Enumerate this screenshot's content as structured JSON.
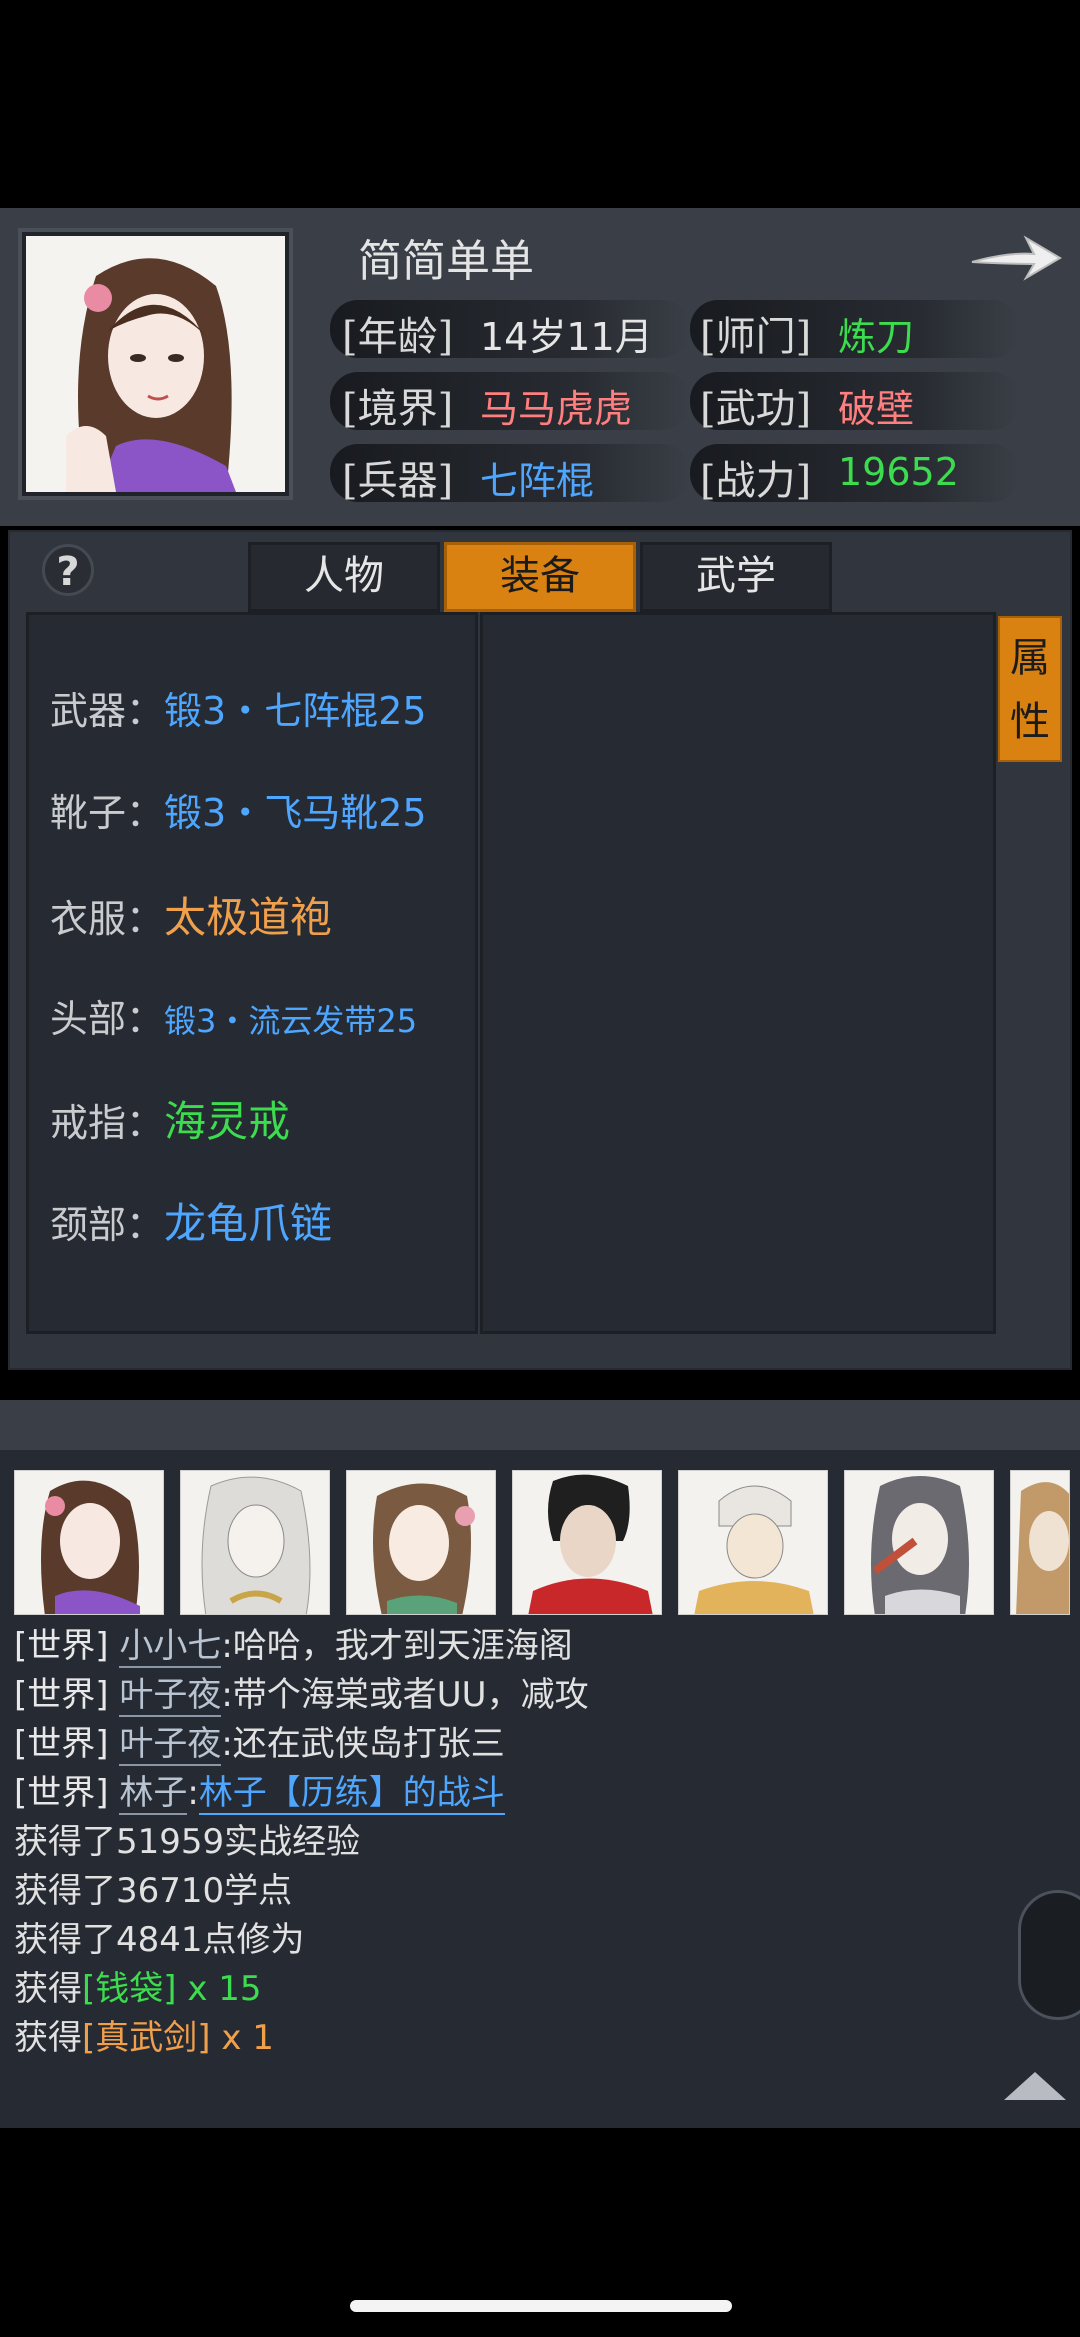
{
  "player": {
    "name": "简简单单",
    "stats": [
      {
        "label": "[年龄]",
        "value": "14岁11月",
        "color": "#e6e6e6"
      },
      {
        "label": "[师门]",
        "value": "炼刀",
        "color": "#3ddc4f"
      },
      {
        "label": "[境界]",
        "value": "马马虎虎",
        "color": "#ff7f7f"
      },
      {
        "label": "[武功]",
        "value": "破壁",
        "color": "#ff7f7f"
      },
      {
        "label": "[兵器]",
        "value": "七阵棍",
        "color": "#4ea6ff"
      },
      {
        "label": "[战力]",
        "value": "19652",
        "color": "#3ddc4f"
      }
    ]
  },
  "help_label": "?",
  "tabs": [
    {
      "label": "人物",
      "active": false
    },
    {
      "label": "装备",
      "active": true
    },
    {
      "label": "武学",
      "active": false
    }
  ],
  "attr_tab": "属性",
  "equipment": [
    {
      "label": "武器：",
      "value": "锻3・七阵棍25",
      "color": "#4ea6ff"
    },
    {
      "label": "靴子：",
      "value": "锻3・飞马靴25",
      "color": "#4ea6ff"
    },
    {
      "label": "衣服：",
      "value": "太极道袍",
      "color": "#f0a04b"
    },
    {
      "label": "头部：",
      "value": "锻3・流云发带25",
      "color": "#4ea6ff"
    },
    {
      "label": "戒指：",
      "value": "海灵戒",
      "color": "#3ddc4f"
    },
    {
      "label": "颈部：",
      "value": "龙龟爪链",
      "color": "#4ea6ff"
    }
  ],
  "chat": [
    {
      "channel": "[世界]",
      "user": "小小七",
      "text": ":哈哈，我才到天涯海阁"
    },
    {
      "channel": "[世界]",
      "user": "叶子夜",
      "text": ":带个海棠或者UU，减攻"
    },
    {
      "channel": "[世界]",
      "user": "叶子夜",
      "text": ":还在武侠岛打张三"
    },
    {
      "channel": "[世界]",
      "user": "林子",
      "text": ":",
      "link": "林子【历练】的战斗"
    }
  ],
  "rewards": [
    "获得了51959实战经验",
    "获得了36710学点",
    "获得了4841点修为"
  ],
  "items": [
    {
      "prefix": "获得",
      "item": "[钱袋]",
      "qty": " x 15",
      "color": "#3ddc4f"
    },
    {
      "prefix": "获得",
      "item": "[真武剑]",
      "qty": " x 1",
      "color": "#f0a04b"
    }
  ]
}
